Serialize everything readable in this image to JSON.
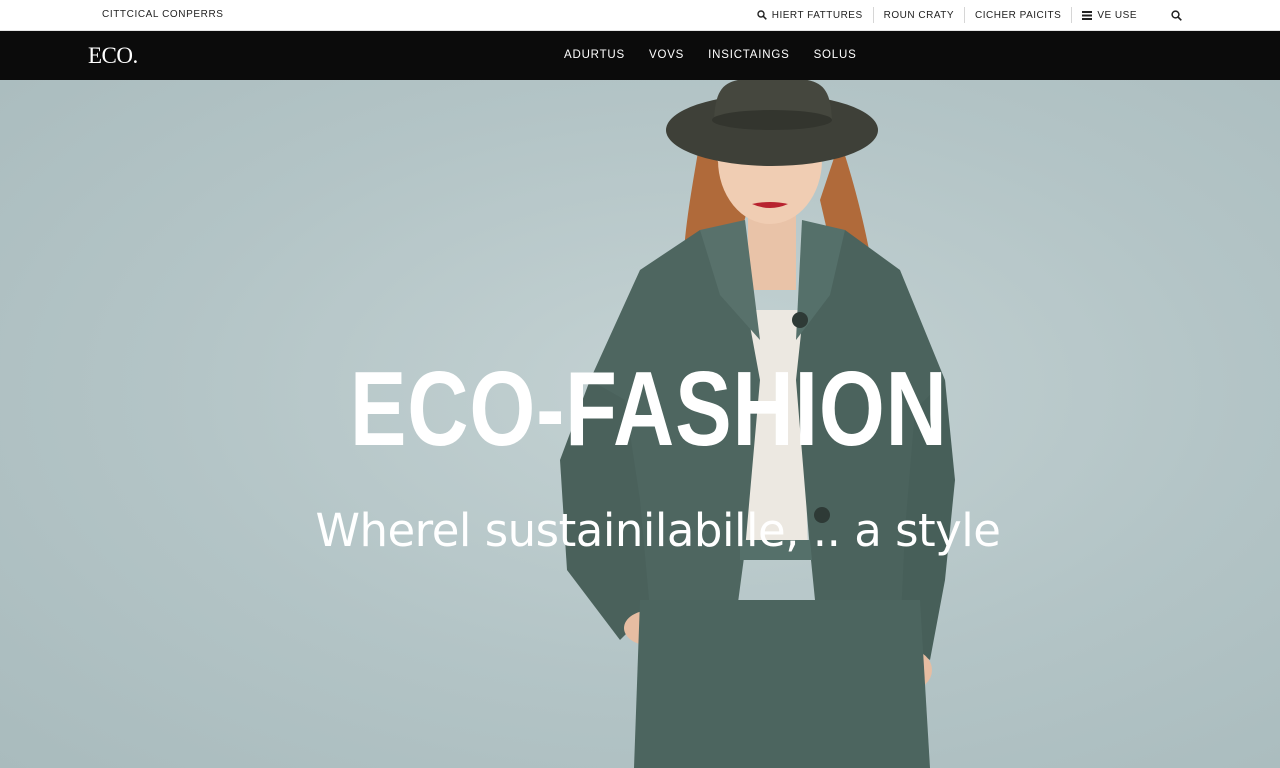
{
  "utility_bar": {
    "left_text": "CITTCICAL CONPERRS",
    "links": [
      {
        "label": "HIERT FATTURES",
        "icon": "search-icon"
      },
      {
        "label": "ROUN CRATY",
        "icon": ""
      },
      {
        "label": "CICHER PAICITS",
        "icon": ""
      },
      {
        "label": "VE USE",
        "icon": "menu-icon"
      }
    ],
    "search_icon": "search-icon"
  },
  "nav": {
    "logo": "ECO.",
    "links": [
      "ADURTUS",
      "VOVS",
      "INSICTAINGS",
      "SOLUS"
    ]
  },
  "hero": {
    "title": "ECO-FASHION",
    "subtitle": "Wherel sustainilabille, .. a style"
  },
  "colors": {
    "nav_background": "#0b0b0b",
    "hero_background": "#b8c8ca",
    "coat": "#4e6660",
    "hat": "#3e4038"
  }
}
